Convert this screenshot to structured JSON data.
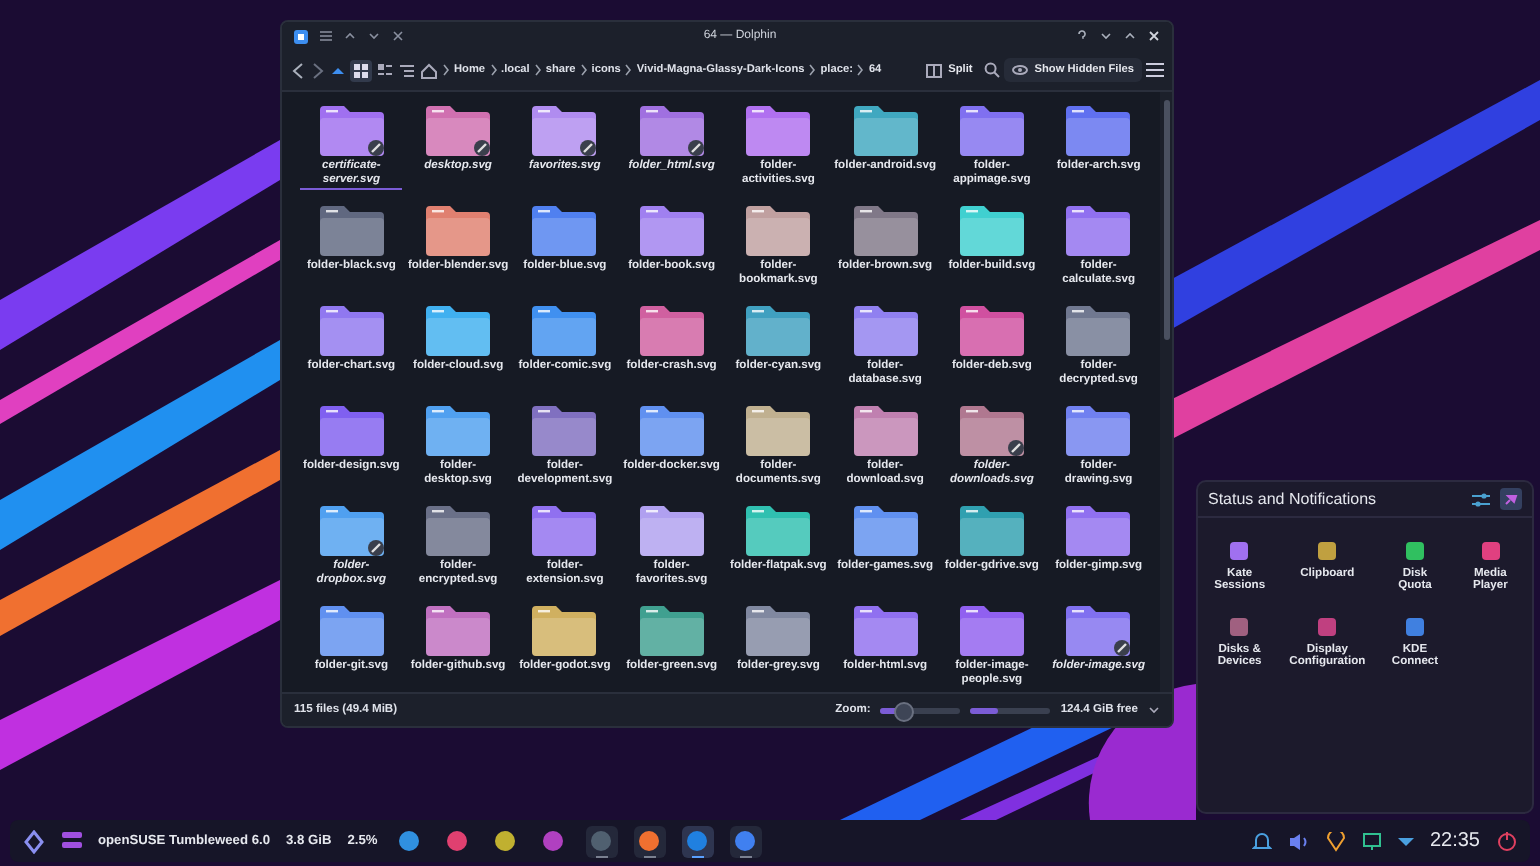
{
  "window": {
    "title": "64 — Dolphin"
  },
  "breadcrumb": [
    "Home",
    ".local",
    "share",
    "icons",
    "Vivid-Magna-Glassy-Dark-Icons",
    "place:",
    "64"
  ],
  "toolbar": {
    "split": "Split",
    "hidden_files": "Show Hidden Files"
  },
  "files": [
    {
      "name": "certificate-server.svg",
      "color": "#a070f0",
      "linked": true,
      "selected": true
    },
    {
      "name": "desktop.svg",
      "color": "#d070b0",
      "linked": true,
      "selected": false
    },
    {
      "name": "favorites.svg",
      "color": "#b08cf0",
      "linked": true,
      "selected": false
    },
    {
      "name": "folder_html.svg",
      "color": "#a070e0",
      "linked": true,
      "selected": false
    },
    {
      "name": "folder-activities.svg",
      "color": "#b070f0",
      "linked": false,
      "selected": false
    },
    {
      "name": "folder-android.svg",
      "color": "#40a8c0",
      "linked": false,
      "selected": false
    },
    {
      "name": "folder-appimage.svg",
      "color": "#8070f0",
      "linked": false,
      "selected": false
    },
    {
      "name": "folder-arch.svg",
      "color": "#6070f0",
      "linked": false,
      "selected": false
    },
    {
      "name": "folder-black.svg",
      "color": "#606880",
      "linked": false,
      "selected": false
    },
    {
      "name": "folder-blender.svg",
      "color": "#e08070",
      "linked": false,
      "selected": false
    },
    {
      "name": "folder-blue.svg",
      "color": "#5080f0",
      "linked": false,
      "selected": false
    },
    {
      "name": "folder-book.svg",
      "color": "#a080f0",
      "linked": false,
      "selected": false
    },
    {
      "name": "folder-bookmark.svg",
      "color": "#c0a0a0",
      "linked": false,
      "selected": false
    },
    {
      "name": "folder-brown.svg",
      "color": "#807888",
      "linked": false,
      "selected": false
    },
    {
      "name": "folder-build.svg",
      "color": "#40d0d0",
      "linked": false,
      "selected": false
    },
    {
      "name": "folder-calculate.svg",
      "color": "#9070f0",
      "linked": false,
      "selected": false
    },
    {
      "name": "folder-chart.svg",
      "color": "#9078f0",
      "linked": false,
      "selected": false
    },
    {
      "name": "folder-cloud.svg",
      "color": "#40b0f0",
      "linked": false,
      "selected": false
    },
    {
      "name": "folder-comic.svg",
      "color": "#4090f0",
      "linked": false,
      "selected": false
    },
    {
      "name": "folder-crash.svg",
      "color": "#d060a0",
      "linked": false,
      "selected": false
    },
    {
      "name": "folder-cyan.svg",
      "color": "#40a0c0",
      "linked": false,
      "selected": false
    },
    {
      "name": "folder-database.svg",
      "color": "#9080f0",
      "linked": false,
      "selected": false
    },
    {
      "name": "folder-deb.svg",
      "color": "#d050a0",
      "linked": false,
      "selected": false
    },
    {
      "name": "folder-decrypted.svg",
      "color": "#707890",
      "linked": false,
      "selected": false
    },
    {
      "name": "folder-design.svg",
      "color": "#8060f0",
      "linked": false,
      "selected": false
    },
    {
      "name": "folder-desktop.svg",
      "color": "#50a0f0",
      "linked": false,
      "selected": false
    },
    {
      "name": "folder-development.svg",
      "color": "#8070c0",
      "linked": false,
      "selected": false
    },
    {
      "name": "folder-docker.svg",
      "color": "#6090f0",
      "linked": false,
      "selected": false
    },
    {
      "name": "folder-documents.svg",
      "color": "#c0b090",
      "linked": false,
      "selected": false
    },
    {
      "name": "folder-download.svg",
      "color": "#c080b0",
      "linked": false,
      "selected": false
    },
    {
      "name": "folder-downloads.svg",
      "color": "#b07890",
      "linked": true,
      "selected": false
    },
    {
      "name": "folder-drawing.svg",
      "color": "#7080f0",
      "linked": false,
      "selected": false
    },
    {
      "name": "folder-dropbox.svg",
      "color": "#50a0f0",
      "linked": true,
      "selected": false
    },
    {
      "name": "folder-encrypted.svg",
      "color": "#6a7088",
      "linked": false,
      "selected": false
    },
    {
      "name": "folder-extension.svg",
      "color": "#9070f0",
      "linked": false,
      "selected": false
    },
    {
      "name": "folder-favorites.svg",
      "color": "#b0a0f0",
      "linked": false,
      "selected": false
    },
    {
      "name": "folder-flatpak.svg",
      "color": "#30c0b0",
      "linked": false,
      "selected": false
    },
    {
      "name": "folder-games.svg",
      "color": "#6090f0",
      "linked": false,
      "selected": false
    },
    {
      "name": "folder-gdrive.svg",
      "color": "#30a0b0",
      "linked": false,
      "selected": false
    },
    {
      "name": "folder-gimp.svg",
      "color": "#9070f0",
      "linked": false,
      "selected": false
    },
    {
      "name": "folder-git.svg",
      "color": "#6090f0",
      "linked": false,
      "selected": false
    },
    {
      "name": "folder-github.svg",
      "color": "#c070c0",
      "linked": false,
      "selected": false
    },
    {
      "name": "folder-godot.svg",
      "color": "#d0b060",
      "linked": false,
      "selected": false
    },
    {
      "name": "folder-green.svg",
      "color": "#40a090",
      "linked": false,
      "selected": false
    },
    {
      "name": "folder-grey.svg",
      "color": "#8088a0",
      "linked": false,
      "selected": false
    },
    {
      "name": "folder-html.svg",
      "color": "#9070f0",
      "linked": false,
      "selected": false
    },
    {
      "name": "folder-image-people.svg",
      "color": "#9060f0",
      "linked": false,
      "selected": false
    },
    {
      "name": "folder-image.svg",
      "color": "#8070f0",
      "linked": true,
      "selected": false
    }
  ],
  "status_bar": {
    "count": "115 files (49.4 MiB)",
    "zoom": {
      "label": "Zoom:",
      "level": 0.3
    },
    "space": {
      "level": 0.35,
      "text": "124.4 GiB free"
    }
  },
  "panel": {
    "title": "Status and Notifications",
    "items": [
      {
        "label": "Kate Sessions",
        "color": "#a070f0"
      },
      {
        "label": "Clipboard",
        "color": "#c0a040"
      },
      {
        "label": "Disk Quota",
        "color": "#30c060"
      },
      {
        "label": "Media Player",
        "color": "#e04080"
      },
      {
        "label": "Disks & Devices",
        "color": "#a06080"
      },
      {
        "label": "Display Configuration",
        "color": "#c04080"
      },
      {
        "label": "KDE Connect",
        "color": "#4080e0"
      }
    ]
  },
  "taskbar": {
    "system": "openSUSE Tumbleweed 6.0",
    "memory": "3.8 GiB",
    "cpu": "2.5%",
    "apps": [
      {
        "color": "#3090e0",
        "running": false,
        "selected": false
      },
      {
        "color": "#e04070",
        "running": false,
        "selected": false
      },
      {
        "color": "#c0b030",
        "running": false,
        "selected": false
      },
      {
        "color": "#b040c0",
        "running": false,
        "selected": false
      },
      {
        "color": "#506070",
        "running": true,
        "selected": false
      },
      {
        "color": "#f07030",
        "running": true,
        "selected": false
      },
      {
        "color": "#2080e0",
        "running": true,
        "selected": true
      },
      {
        "color": "#4080f0",
        "running": true,
        "selected": false
      }
    ],
    "clock": "22:35"
  }
}
